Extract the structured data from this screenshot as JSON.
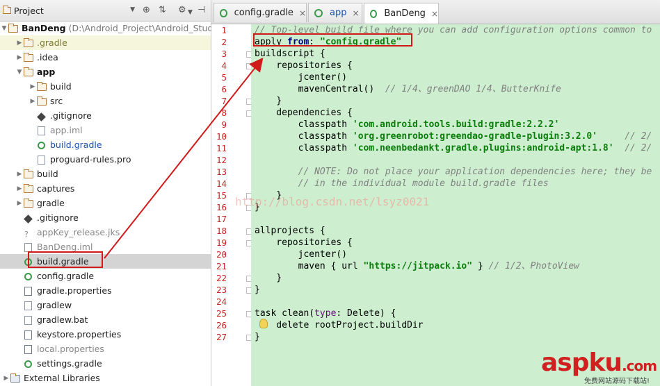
{
  "project_panel": {
    "selector_label": "Project",
    "toolbar_icons": [
      "target-icon",
      "collapse-icon",
      "gear-icon",
      "hide-icon"
    ],
    "root": {
      "name": "BanDeng",
      "path": "(D:\\Android_Project\\Android_Studi"
    },
    "items": [
      {
        "label": ".gradle",
        "indent": 1,
        "icon": "folder-icon",
        "twisty": "▶",
        "style": "olive",
        "highlight": true
      },
      {
        "label": ".idea",
        "indent": 1,
        "icon": "folder-icon",
        "twisty": "▶",
        "style": "normal"
      },
      {
        "label": "app",
        "indent": 1,
        "icon": "module-folder-icon",
        "twisty": "▼",
        "style": "bold"
      },
      {
        "label": "build",
        "indent": 2,
        "icon": "folder-icon",
        "twisty": "▶",
        "style": "normal"
      },
      {
        "label": "src",
        "indent": 2,
        "icon": "folder-icon",
        "twisty": "▶",
        "style": "normal"
      },
      {
        "label": ".gitignore",
        "indent": 2,
        "icon": "git-icon",
        "twisty": "",
        "style": "normal"
      },
      {
        "label": "app.iml",
        "indent": 2,
        "icon": "file-icon",
        "twisty": "",
        "style": "grey"
      },
      {
        "label": "build.gradle",
        "indent": 2,
        "icon": "gradle-icon",
        "twisty": "",
        "style": "blue"
      },
      {
        "label": "proguard-rules.pro",
        "indent": 2,
        "icon": "file-icon",
        "twisty": "",
        "style": "normal"
      },
      {
        "label": "build",
        "indent": 1,
        "icon": "folder-icon",
        "twisty": "▶",
        "style": "normal"
      },
      {
        "label": "captures",
        "indent": 1,
        "icon": "folder-icon",
        "twisty": "▶",
        "style": "normal"
      },
      {
        "label": "gradle",
        "indent": 1,
        "icon": "folder-icon",
        "twisty": "▶",
        "style": "normal"
      },
      {
        "label": ".gitignore",
        "indent": 1,
        "icon": "git-icon",
        "twisty": "",
        "style": "normal"
      },
      {
        "label": "appKey_release.jks",
        "indent": 1,
        "icon": "keystore-icon",
        "twisty": "",
        "style": "grey"
      },
      {
        "label": "BanDeng.iml",
        "indent": 1,
        "icon": "file-icon",
        "twisty": "",
        "style": "grey"
      },
      {
        "label": "build.gradle",
        "indent": 1,
        "icon": "gradle-icon",
        "twisty": "",
        "style": "normal",
        "selected": true
      },
      {
        "label": "config.gradle",
        "indent": 1,
        "icon": "gradle-icon",
        "twisty": "",
        "style": "normal"
      },
      {
        "label": "gradle.properties",
        "indent": 1,
        "icon": "properties-icon",
        "twisty": "",
        "style": "normal"
      },
      {
        "label": "gradlew",
        "indent": 1,
        "icon": "file-icon",
        "twisty": "",
        "style": "normal"
      },
      {
        "label": "gradlew.bat",
        "indent": 1,
        "icon": "file-icon",
        "twisty": "",
        "style": "normal"
      },
      {
        "label": "keystore.properties",
        "indent": 1,
        "icon": "properties-icon",
        "twisty": "",
        "style": "normal"
      },
      {
        "label": "local.properties",
        "indent": 1,
        "icon": "properties-icon",
        "twisty": "",
        "style": "grey"
      },
      {
        "label": "settings.gradle",
        "indent": 1,
        "icon": "gradle-icon",
        "twisty": "",
        "style": "normal"
      },
      {
        "label": "External Libraries",
        "indent": 0,
        "icon": "library-icon",
        "twisty": "▶",
        "style": "normal"
      }
    ]
  },
  "editor_tabs": [
    {
      "label": "config.gradle",
      "active": false
    },
    {
      "label": "app",
      "active": false
    },
    {
      "label": "BanDeng",
      "active": true
    }
  ],
  "line_numbers": [
    "1",
    "2",
    "3",
    "4",
    "5",
    "6",
    "7",
    "8",
    "9",
    "10",
    "11",
    "12",
    "13",
    "14",
    "15",
    "16",
    "17",
    "18",
    "19",
    "20",
    "21",
    "22",
    "23",
    "24",
    "25",
    "26",
    "27"
  ],
  "code_lines": [
    [
      {
        "c": "cmt",
        "t": "// Top-level build file where you can add configuration options common to"
      }
    ],
    [
      {
        "c": "pl",
        "t": "apply "
      },
      {
        "c": "kw",
        "t": "from"
      },
      {
        "c": "pl",
        "t": ": "
      },
      {
        "c": "str",
        "t": "\"config.gradle\""
      }
    ],
    [
      {
        "c": "pl",
        "t": "buildscript {"
      }
    ],
    [
      {
        "c": "pl",
        "t": "    repositories {"
      }
    ],
    [
      {
        "c": "pl",
        "t": "        jcenter()"
      }
    ],
    [
      {
        "c": "pl",
        "t": "        mavenCentral()  "
      },
      {
        "c": "cmt",
        "t": "// 1/4、greenDAO 1/4、ButterKnife"
      }
    ],
    [
      {
        "c": "pl",
        "t": "    }"
      }
    ],
    [
      {
        "c": "pl",
        "t": "    dependencies {"
      }
    ],
    [
      {
        "c": "pl",
        "t": "        classpath "
      },
      {
        "c": "str",
        "t": "'com.android.tools.build:gradle:2.2.2'"
      }
    ],
    [
      {
        "c": "pl",
        "t": "        classpath "
      },
      {
        "c": "str",
        "t": "'org.greenrobot:greendao-gradle-plugin:3.2.0'"
      },
      {
        "c": "pl",
        "t": "     "
      },
      {
        "c": "cmt",
        "t": "// 2/"
      }
    ],
    [
      {
        "c": "pl",
        "t": "        classpath "
      },
      {
        "c": "str",
        "t": "'com.neenbedankt.gradle.plugins:android-apt:1.8'"
      },
      {
        "c": "pl",
        "t": "  "
      },
      {
        "c": "cmt",
        "t": "// 2/"
      }
    ],
    [
      {
        "c": "pl",
        "t": ""
      }
    ],
    [
      {
        "c": "pl",
        "t": "        "
      },
      {
        "c": "cmt",
        "t": "// NOTE: Do not place your application dependencies here; they be"
      }
    ],
    [
      {
        "c": "pl",
        "t": "        "
      },
      {
        "c": "cmt",
        "t": "// in the individual module build.gradle files"
      }
    ],
    [
      {
        "c": "pl",
        "t": "    }"
      }
    ],
    [
      {
        "c": "pl",
        "t": "}"
      }
    ],
    [
      {
        "c": "pl",
        "t": ""
      }
    ],
    [
      {
        "c": "pl",
        "t": "allprojects {"
      }
    ],
    [
      {
        "c": "pl",
        "t": "    repositories {"
      }
    ],
    [
      {
        "c": "pl",
        "t": "        jcenter()"
      }
    ],
    [
      {
        "c": "pl",
        "t": "        maven { url "
      },
      {
        "c": "str",
        "t": "\"https://jitpack.io\""
      },
      {
        "c": "pl",
        "t": " } "
      },
      {
        "c": "cmt",
        "t": "// 1/2、PhotoView"
      }
    ],
    [
      {
        "c": "pl",
        "t": "    }"
      }
    ],
    [
      {
        "c": "pl",
        "t": "}"
      }
    ],
    [
      {
        "c": "pl",
        "t": ""
      }
    ],
    [
      {
        "c": "pl",
        "t": "task clean("
      },
      {
        "c": "name",
        "t": "type"
      },
      {
        "c": "pl",
        "t": ": Delete) {"
      }
    ],
    [
      {
        "c": "pl",
        "t": "    delete rootProject.buildDir"
      }
    ],
    [
      {
        "c": "pl",
        "t": "}"
      }
    ]
  ],
  "watermark": "http://blog.csdn.net/lsyz0021",
  "logo": {
    "main": "aspku",
    "suffix": ".com",
    "sub": "免费网站源码下载站!"
  },
  "colors": {
    "editor_bg": "#cdefd0",
    "annotation_red": "#d01a1a",
    "line_number": "#c42424"
  }
}
